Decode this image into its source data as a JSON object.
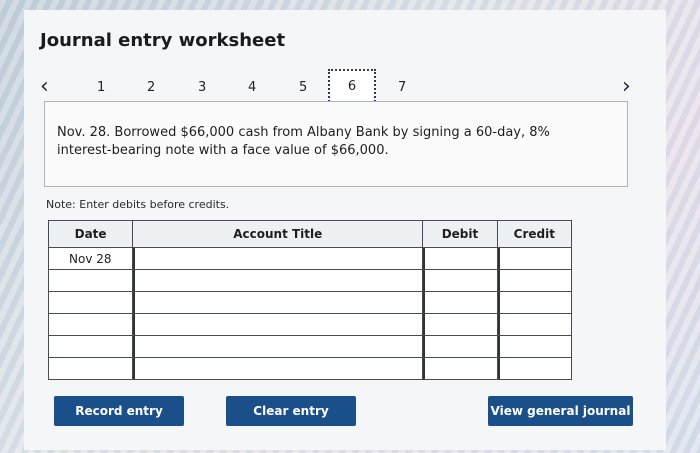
{
  "title": "Journal entry worksheet",
  "pager": {
    "prev_icon": "chevron-left-icon",
    "next_icon": "chevron-right-icon",
    "pages": [
      "1",
      "2",
      "3",
      "4",
      "5",
      "6",
      "7"
    ],
    "active_page": "6"
  },
  "prompt": "Nov. 28. Borrowed $66,000 cash from Albany Bank by signing a 60-day, 8% interest-bearing note with a face value of $66,000.",
  "note": "Note: Enter debits before credits.",
  "table": {
    "headers": {
      "date": "Date",
      "account": "Account Title",
      "debit": "Debit",
      "credit": "Credit"
    },
    "rows": [
      {
        "date": "Nov 28",
        "account": "",
        "debit": "",
        "credit": ""
      },
      {
        "date": "",
        "account": "",
        "debit": "",
        "credit": ""
      },
      {
        "date": "",
        "account": "",
        "debit": "",
        "credit": ""
      },
      {
        "date": "",
        "account": "",
        "debit": "",
        "credit": ""
      },
      {
        "date": "",
        "account": "",
        "debit": "",
        "credit": ""
      },
      {
        "date": "",
        "account": "",
        "debit": "",
        "credit": ""
      }
    ]
  },
  "buttons": {
    "record": "Record entry",
    "clear": "Clear entry",
    "view": "View general journal"
  },
  "colors": {
    "button_bg": "#1b4f8a",
    "button_text": "#ffffff"
  }
}
